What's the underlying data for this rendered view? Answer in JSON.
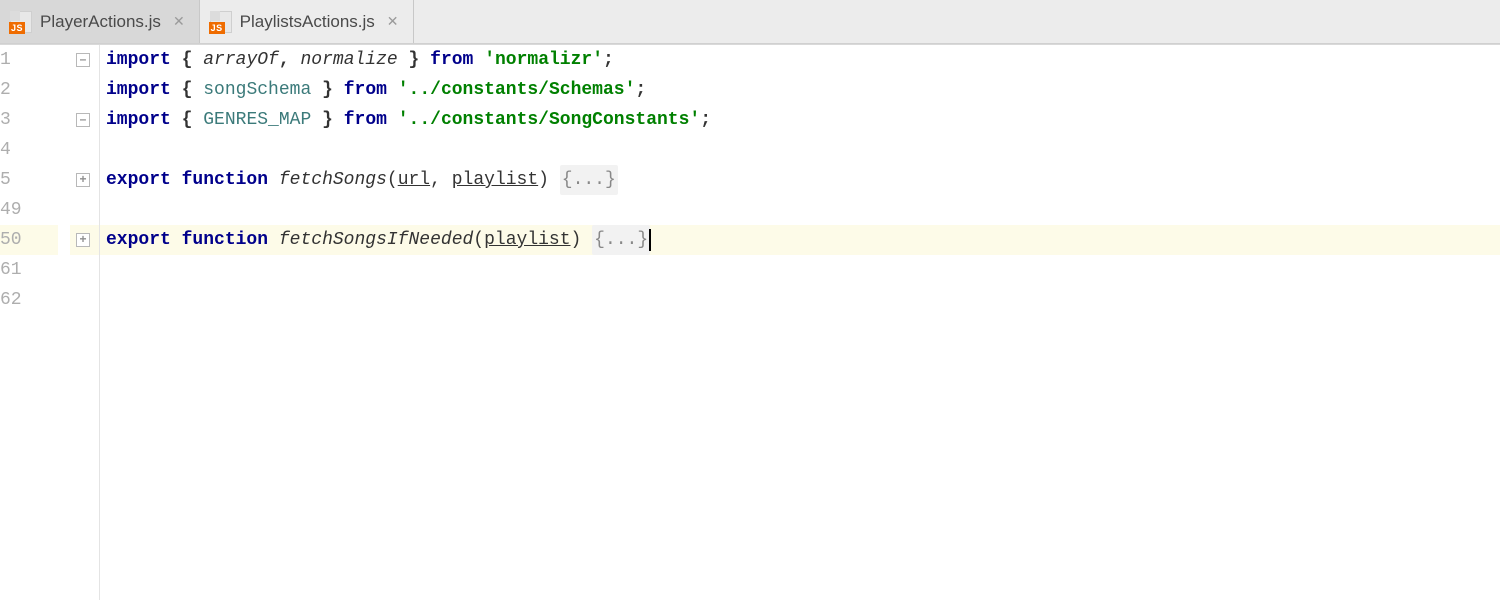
{
  "tabs": [
    {
      "label": "PlayerActions.js",
      "active": false
    },
    {
      "label": "PlaylistsActions.js",
      "active": true
    }
  ],
  "lines": {
    "l1_num": "1",
    "l2_num": "2",
    "l3_num": "3",
    "l4_num": "4",
    "l5_num": "5",
    "l49_num": "49",
    "l50_num": "50",
    "l61_num": "61",
    "l62_num": "62"
  },
  "fold": {
    "minus": "–",
    "plus": "+"
  },
  "code": {
    "kw_import": "import",
    "kw_from": "from",
    "kw_export": "export",
    "kw_function": "function",
    "lbrace": "{",
    "rbrace": "}",
    "lparen": "(",
    "rparen": ")",
    "semi": ";",
    "comma": ",",
    "space": " ",
    "arrayOf": "arrayOf",
    "normalize": "normalize",
    "songSchema": "songSchema",
    "genresMap": "GENRES_MAP",
    "str_normalizr": "'normalizr'",
    "str_schemas": "'../constants/Schemas'",
    "str_songconst": "'../constants/SongConstants'",
    "fn_fetchSongs": "fetchSongs",
    "fn_fetchIfNeeded": "fetchSongsIfNeeded",
    "p_url": "url",
    "p_playlist": "playlist",
    "folded": "{...}"
  }
}
